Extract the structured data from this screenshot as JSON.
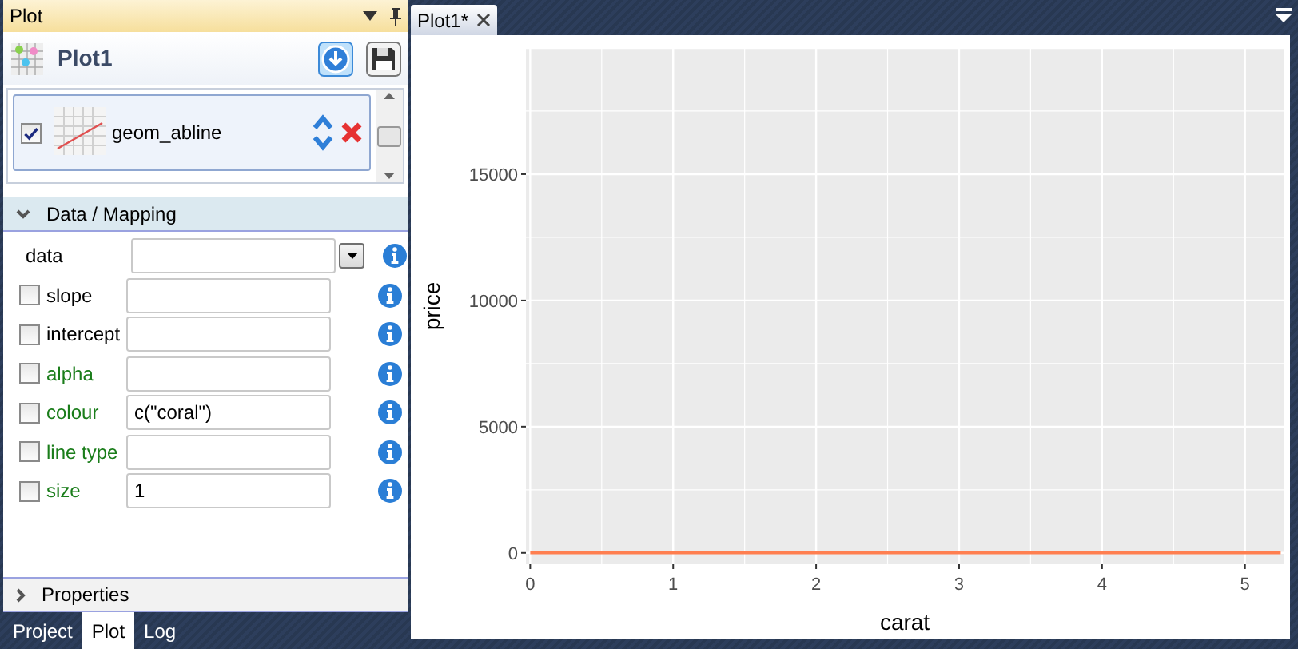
{
  "panel": {
    "title": "Plot",
    "plot_name": "Plot1",
    "layers": [
      {
        "name": "geom_abline",
        "checked": true
      }
    ],
    "mapping_section": {
      "title": "Data / Mapping",
      "expanded": true
    },
    "params": [
      {
        "kind": "dropdown",
        "label": "data",
        "color": "#000000"
      },
      {
        "kind": "checkbox",
        "label": "slope",
        "checked": false,
        "color": "#000000"
      },
      {
        "kind": "checkbox",
        "label": "intercept",
        "checked": false,
        "color": "#000000"
      },
      {
        "kind": "checkbox",
        "label": "alpha",
        "checked": false,
        "color": "#1a7d1a"
      },
      {
        "kind": "checkbox",
        "label": "colour",
        "checked": false,
        "color": "#1a7d1a",
        "value": "c(\"coral\")"
      },
      {
        "kind": "checkbox",
        "label": "line type",
        "checked": false,
        "color": "#1a7d1a"
      },
      {
        "kind": "checkbox",
        "label": "size",
        "checked": false,
        "color": "#1a7d1a",
        "value": "1"
      }
    ],
    "properties_section": {
      "title": "Properties",
      "expanded": false
    },
    "bottom_tabs": [
      {
        "label": "Project",
        "selected": false
      },
      {
        "label": "Plot",
        "selected": true
      },
      {
        "label": "Log",
        "selected": false
      }
    ]
  },
  "document_tabs": [
    {
      "label": "Plot1*",
      "selected": true
    }
  ],
  "plot": {
    "chart_data": {
      "type": "line",
      "xlabel": "carat",
      "ylabel": "price",
      "xlim": [
        -0.03,
        5.27
      ],
      "ylim": [
        -450,
        20000
      ],
      "xticks": [
        0,
        1,
        2,
        3,
        4,
        5
      ],
      "yticks": [
        0,
        5000,
        10000,
        15000
      ],
      "grid": true,
      "x": [
        0,
        5.25
      ],
      "series": [
        {
          "color": "#ff7f50",
          "values": [
            0,
            0
          ]
        }
      ]
    }
  }
}
